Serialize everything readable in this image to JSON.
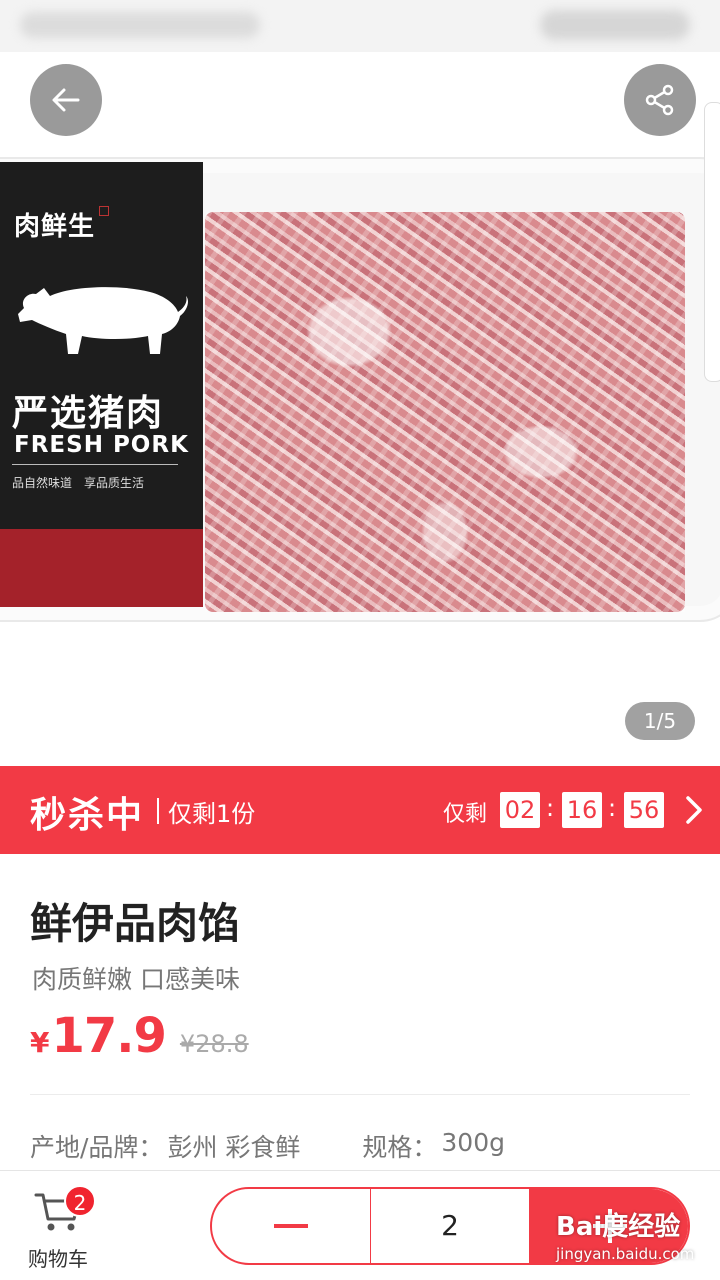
{
  "hero": {
    "pager_text": "1/5",
    "package": {
      "brand": "肉鲜生",
      "title_cn": "严选猪肉",
      "title_en": "FRESH PORK",
      "slogan": "品自然味道　享品质生活"
    }
  },
  "flash_sale": {
    "title": "秒杀中",
    "stock_text": "仅剩1份",
    "remain_label": "仅剩",
    "hours": "02",
    "minutes": "16",
    "seconds": "56",
    "colon": ":"
  },
  "product": {
    "title": "鲜伊品肉馅",
    "subtitle": "肉质鲜嫩 口感美味",
    "currency": "¥",
    "price": "17.9",
    "original_price": "¥28.8",
    "spec_origin_label": "产地/品牌：",
    "spec_origin_value": "彭州 彩食鲜",
    "spec_size_label": "规格：",
    "spec_size_value": "300g"
  },
  "bottom_bar": {
    "cart_label": "购物车",
    "cart_count": "2",
    "quantity": "2"
  },
  "watermark": {
    "main": "Bai度经验",
    "sub": "jingyan.baidu.com"
  },
  "colors": {
    "accent": "#f23a45",
    "label_red": "#a4222a",
    "label_black": "#1d1d1d"
  },
  "icons": [
    "back-arrow-icon",
    "share-icon",
    "chevron-right-icon",
    "cart-icon",
    "minus-icon",
    "plus-icon",
    "pig-icon"
  ]
}
